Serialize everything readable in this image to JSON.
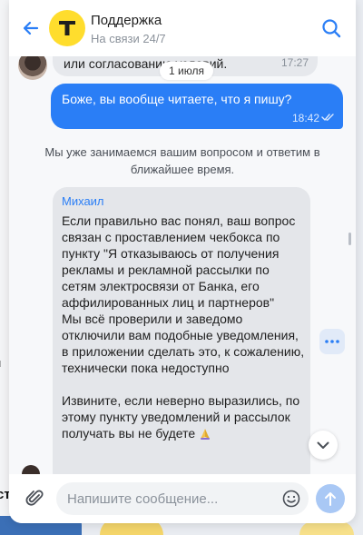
{
  "header": {
    "title": "Поддержка",
    "subtitle": "На связи 24/7",
    "logo_letter": "Т",
    "logo_color": "#ffdd2d"
  },
  "messages": {
    "prev_incoming": {
      "text": "или согласованию условий.",
      "time": "17:27"
    },
    "date_divider": "1 июля",
    "outgoing": {
      "text": "Боже, вы вообще читаете, что я пишу?",
      "time": "18:42",
      "status": "read"
    },
    "system": "Мы уже занимаемся вашим вопросом и ответим в ближайшее время.",
    "agent": {
      "name": "Михаил",
      "text": "Если правильно вас понял, ваш вопрос связан с проставлением чекбокса по пункту \"Я отказываюсь от получения рекламы и рекламной рассылки по сетям электросвязи от Банка, его аффилированных лиц и партнеров\"\nМы всё проверили и заведомо отключили вам подобные уведомления, в приложении сделать это, к сожалению, технически пока недоступно\n\nИзвините, если неверно выразились, по этому пункту уведомлений и рассылок получать вы не будете"
    }
  },
  "composer": {
    "placeholder": "Напишите сообщение..."
  },
  "background": {
    "left_fragment_1": "й",
    "left_fragment_2": "ст"
  },
  "colors": {
    "accent": "#2a7ef6",
    "incoming_bubble": "#e4e6ea",
    "send_disabled": "#a9c8f5"
  },
  "icons": [
    "back-arrow-icon",
    "search-icon",
    "read-checks-icon",
    "more-dots-icon",
    "chevron-down-icon",
    "paperclip-icon",
    "emoji-icon",
    "send-arrow-icon",
    "praying-hands-icon"
  ]
}
